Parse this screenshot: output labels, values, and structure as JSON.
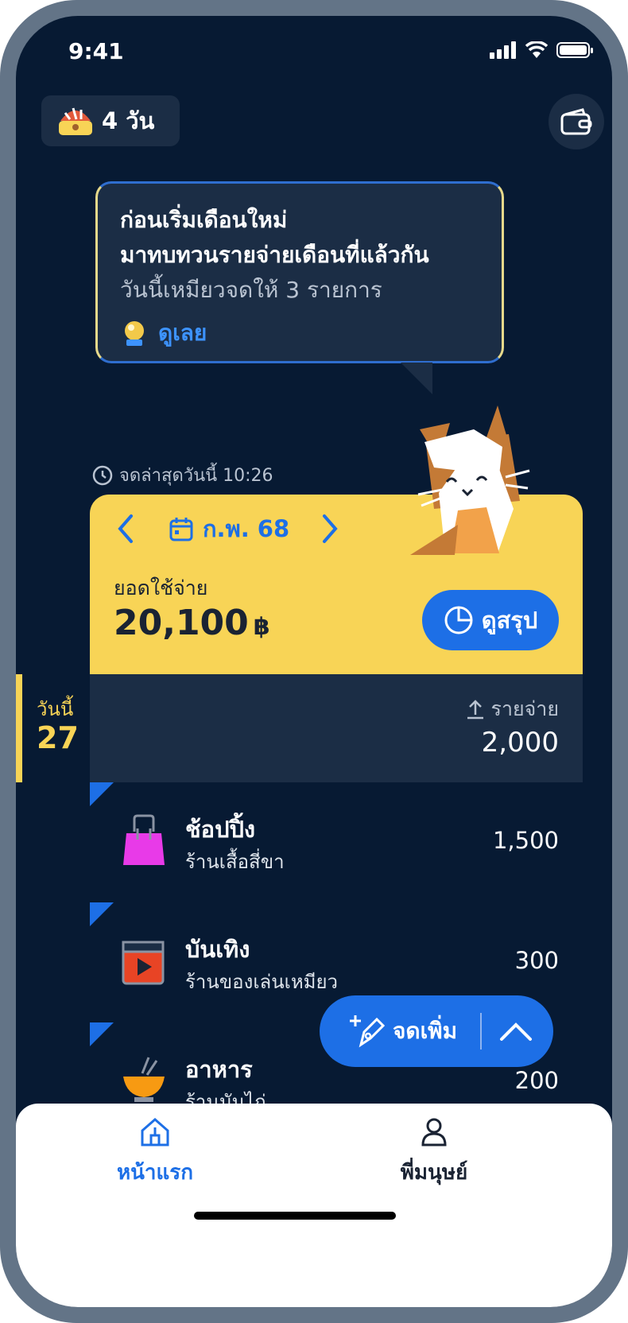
{
  "status_bar": {
    "time": "9:41"
  },
  "streak": {
    "label": "4 วัน"
  },
  "banner": {
    "title_line1": "ก่อนเริ่มเดือนใหม่",
    "title_line2": "มาทบทวนรายจ่ายเดือนที่แล้วกัน",
    "subtitle": "วันนี้เหมียวจดให้ 3 รายการ",
    "link_label": "ดูเลย"
  },
  "last_note": "จดล่าสุดวันนี้ 10:26",
  "card": {
    "month": "ก.พ. 68",
    "spend_label": "ยอดใช้จ่าย",
    "spend_value": "20,100",
    "currency": "฿",
    "summary_label": "ดูสรุป"
  },
  "day": {
    "today_word": "วันนี้",
    "date": "27",
    "expense_label": "รายจ่าย",
    "expense_total": "2,000"
  },
  "transactions": [
    {
      "title": "ช้อปปิ้ง",
      "subtitle": "ร้านเสื้อสี่ขา",
      "amount": "1,500",
      "icon": "shopping-bag-icon"
    },
    {
      "title": "บันเทิง",
      "subtitle": "ร้านของเล่นเหมียว",
      "amount": "300",
      "icon": "entertainment-icon"
    },
    {
      "title": "อาหาร",
      "subtitle": "ร้านมันไก่",
      "amount": "200",
      "icon": "food-bowl-icon"
    }
  ],
  "fab": {
    "label": "จดเพิ่ม"
  },
  "bottom_nav": {
    "home_label": "หน้าแรก",
    "person_label": "พี่มนุษย์"
  },
  "colors": {
    "background": "#071a33",
    "panel": "#1b2d45",
    "accent_blue": "#1d6fe6",
    "accent_yellow": "#f8d456"
  }
}
